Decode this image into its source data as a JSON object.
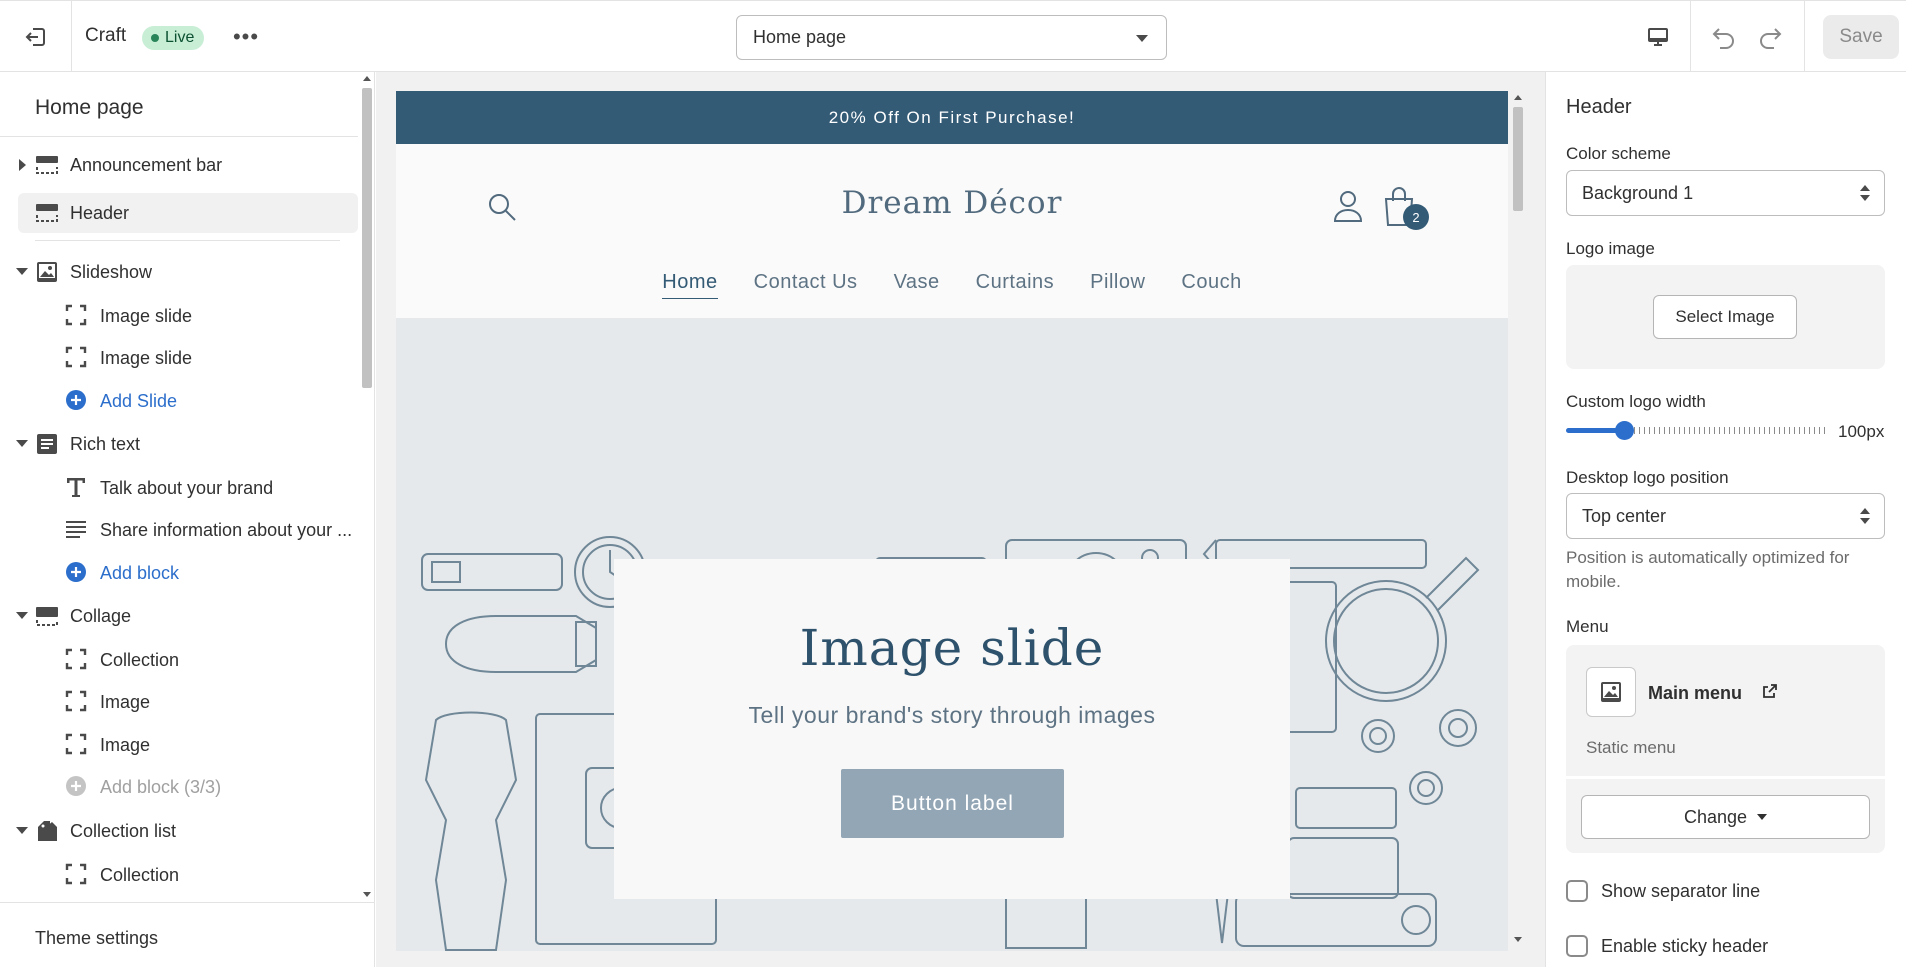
{
  "topbar": {
    "theme_name": "Craft",
    "live_badge": "Live",
    "more_label": "•••",
    "page_select": "Home page",
    "save_label": "Save",
    "icons": {
      "exit": "exit-icon",
      "device": "desktop-icon",
      "undo": "undo-icon",
      "redo": "redo-icon"
    }
  },
  "left": {
    "title": "Home page",
    "sections": [
      {
        "label": "Announcement bar",
        "collapsed": true
      },
      {
        "label": "Header"
      },
      {
        "label": "Slideshow",
        "blocks": [
          "Image slide",
          "Image slide"
        ],
        "add": "Add Slide"
      },
      {
        "label": "Rich text",
        "blocks": [
          "Talk about your brand",
          "Share information about your ..."
        ],
        "add": "Add block"
      },
      {
        "label": "Collage",
        "blocks": [
          "Collection",
          "Image",
          "Image"
        ],
        "add": "Add block (3/3)"
      },
      {
        "label": "Collection list",
        "blocks": [
          "Collection"
        ]
      }
    ],
    "footer": "Theme settings"
  },
  "preview": {
    "announcement": "20% Off On First Purchase!",
    "logo": "Dream Décor",
    "cart_count": "2",
    "nav": [
      "Home",
      "Contact Us",
      "Vase",
      "Curtains",
      "Pillow",
      "Couch"
    ],
    "active_nav": "Home",
    "slide_title": "Image slide",
    "slide_subtitle": "Tell your brand's story through images",
    "slide_button": "Button label",
    "colors": {
      "announcement_bg": "#345b76",
      "hero_bg": "#e6e9ec",
      "button_bg": "#93a6b5"
    }
  },
  "right": {
    "title": "Header",
    "color_scheme_label": "Color scheme",
    "color_scheme_value": "Background 1",
    "logo_image_label": "Logo image",
    "select_image": "Select Image",
    "logo_width_label": "Custom logo width",
    "logo_width_value": "100px",
    "logo_width_fraction": 0.22,
    "logo_position_label": "Desktop logo position",
    "logo_position_value": "Top center",
    "logo_position_help": "Position is automatically optimized for mobile.",
    "menu_label": "Menu",
    "menu_name": "Main menu",
    "menu_static": "Static menu",
    "menu_change": "Change",
    "show_separator": "Show separator line",
    "sticky_header": "Enable sticky header",
    "accent": "#2c6ecb"
  }
}
